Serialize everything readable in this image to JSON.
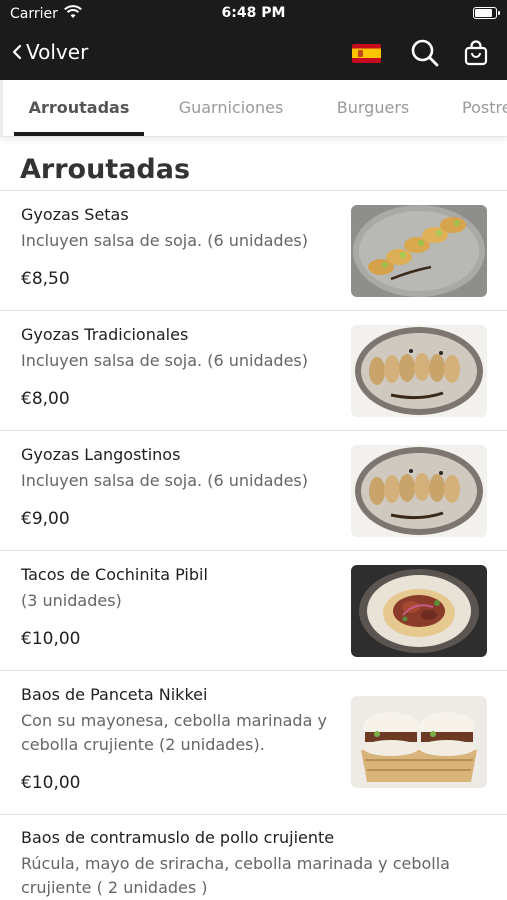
{
  "status_bar": {
    "carrier": "Carrier",
    "time": "6:48 PM",
    "battery_level": 0.9
  },
  "nav": {
    "back_label": "Volver",
    "language_flag": "spain-flag",
    "search_icon": "search-icon",
    "cart_icon": "shopping-bag-icon",
    "bg_color": "#1b1b1b"
  },
  "tabs": [
    {
      "label": "Arroutadas",
      "active": true
    },
    {
      "label": "Guarniciones",
      "active": false
    },
    {
      "label": "Burguers",
      "active": false
    },
    {
      "label": "Postres",
      "active": false
    }
  ],
  "section": {
    "title": "Arroutadas"
  },
  "items": [
    {
      "name": "Gyozas Setas",
      "description": "Incluyen salsa de soja. (6 unidades)",
      "price": "€8,50",
      "image": "gyozas-setas-photo"
    },
    {
      "name": "Gyozas Tradicionales",
      "description": "Incluyen salsa de soja. (6 unidades)",
      "price": "€8,00",
      "image": "gyozas-tradicionales-photo"
    },
    {
      "name": "Gyozas Langostinos",
      "description": "Incluyen salsa de soja. (6 unidades)",
      "price": "€9,00",
      "image": "gyozas-langostinos-photo"
    },
    {
      "name": "Tacos de Cochinita Pibil",
      "description": "(3 unidades)",
      "price": "€10,00",
      "image": "tacos-cochinita-photo"
    },
    {
      "name": "Baos de Panceta Nikkei",
      "description": "Con su mayonesa, cebolla marinada y cebolla crujiente (2 unidades).",
      "price": "€10,00",
      "image": "baos-panceta-photo"
    },
    {
      "name": "Baos de contramuslo de pollo crujiente",
      "description": "Rúcula, mayo de sriracha, cebolla marinada y cebolla crujiente ( 2 unidades )"
    }
  ]
}
